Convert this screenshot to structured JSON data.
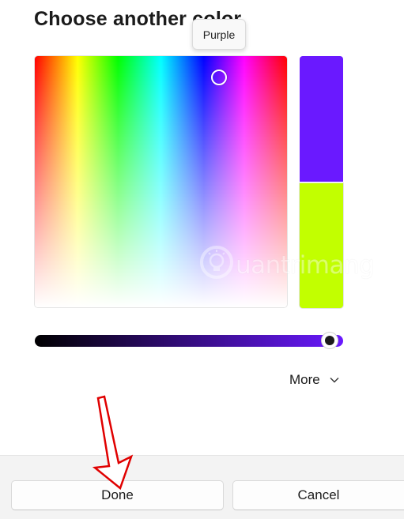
{
  "dialog": {
    "title": "Choose another color"
  },
  "tooltip": {
    "text": "Purple"
  },
  "picker": {
    "selected_color": "#6a19ff",
    "original_color": "#c2ff00",
    "brightness_gradient_end": "#6a19ff",
    "brightness_level": 0.98
  },
  "more": {
    "label": "More",
    "icon": "chevron-down-icon"
  },
  "buttons": {
    "done_label": "Done",
    "cancel_label": "Cancel"
  },
  "watermark": {
    "brand_text": "uantrimang",
    "icon": "lightbulb-icon"
  },
  "annotation": {
    "icon": "red-arrow-pointer",
    "color": "#e00000"
  }
}
